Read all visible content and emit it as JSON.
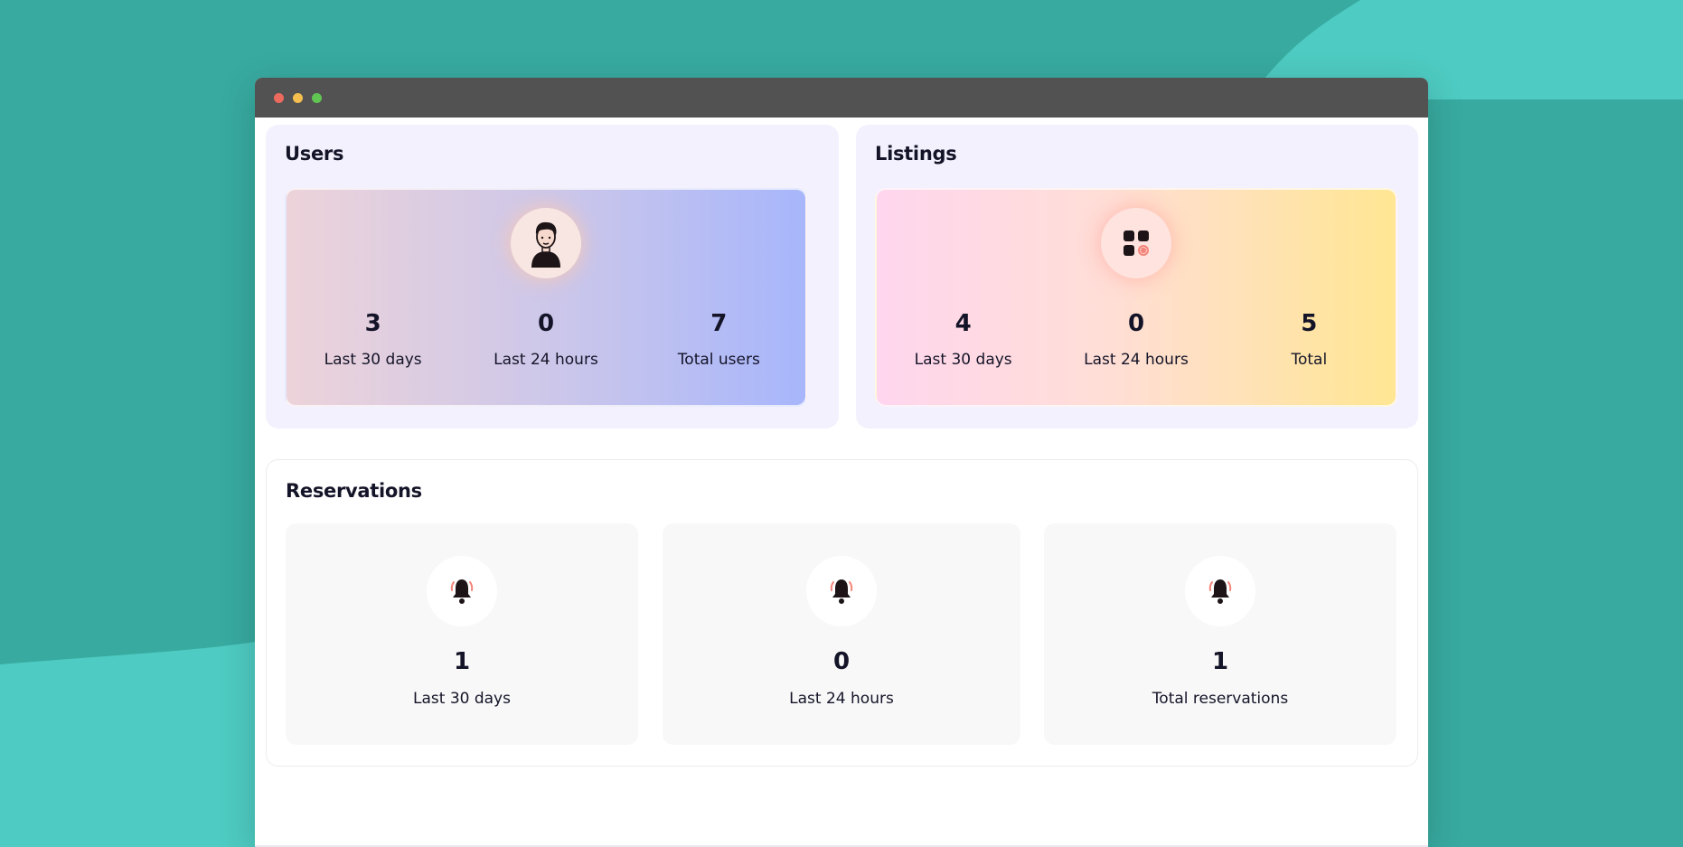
{
  "window": {
    "controls": [
      "close",
      "minimize",
      "maximize"
    ]
  },
  "users": {
    "title": "Users",
    "icon": "user-avatar-icon",
    "stats": [
      {
        "value": "3",
        "label": "Last 30 days"
      },
      {
        "value": "0",
        "label": "Last 24 hours"
      },
      {
        "value": "7",
        "label": "Total users"
      }
    ]
  },
  "listings": {
    "title": "Listings",
    "icon": "grid-icon",
    "stats": [
      {
        "value": "4",
        "label": "Last 30 days"
      },
      {
        "value": "0",
        "label": "Last 24 hours"
      },
      {
        "value": "5",
        "label": "Total"
      }
    ]
  },
  "reservations": {
    "title": "Reservations",
    "icon": "bell-icon",
    "stats": [
      {
        "value": "1",
        "label": "Last 30 days"
      },
      {
        "value": "0",
        "label": "Last 24 hours"
      },
      {
        "value": "1",
        "label": "Total reservations"
      }
    ]
  },
  "colors": {
    "background": "#38aaa0",
    "background_light": "#4ecbc2",
    "titlebar": "#525252",
    "panel": "#f3f1fd",
    "text": "#141428"
  }
}
